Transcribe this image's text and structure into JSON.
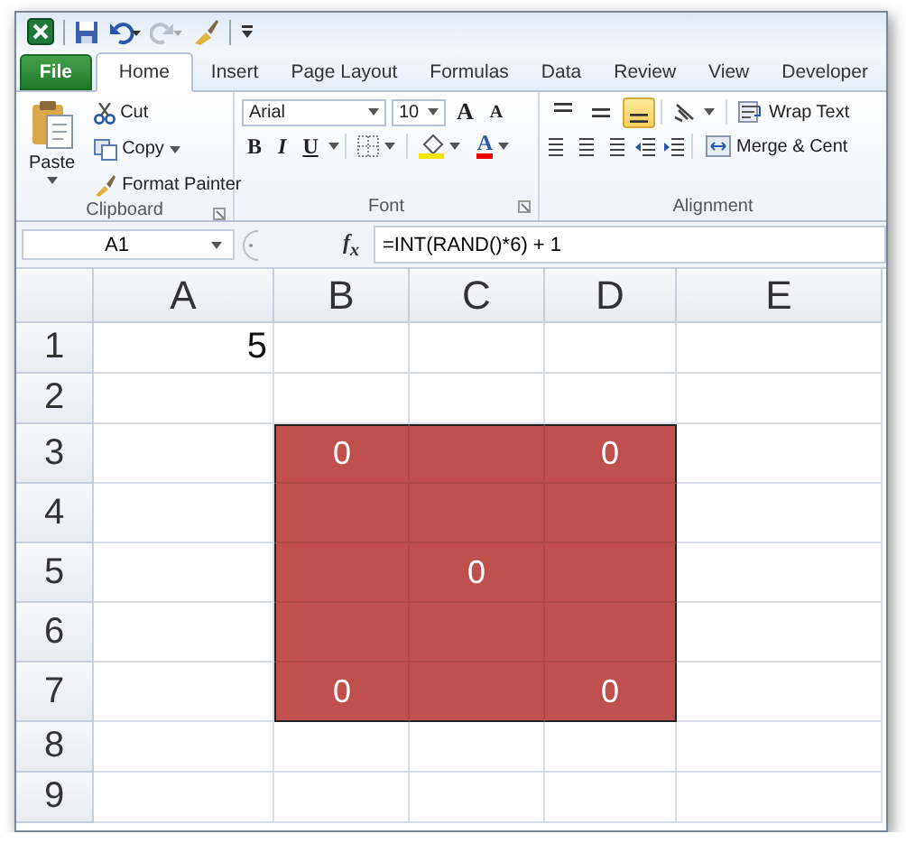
{
  "tabs": [
    {
      "label": "File",
      "kind": "file",
      "selected": false
    },
    {
      "label": "Home",
      "kind": "tab",
      "selected": true
    },
    {
      "label": "Insert",
      "kind": "tab",
      "selected": false
    },
    {
      "label": "Page Layout",
      "kind": "tab",
      "selected": false
    },
    {
      "label": "Formulas",
      "kind": "tab",
      "selected": false
    },
    {
      "label": "Data",
      "kind": "tab",
      "selected": false
    },
    {
      "label": "Review",
      "kind": "tab",
      "selected": false
    },
    {
      "label": "View",
      "kind": "tab",
      "selected": false
    },
    {
      "label": "Developer",
      "kind": "tab",
      "selected": false
    }
  ],
  "ribbon": {
    "clipboard": {
      "label": "Clipboard",
      "paste": "Paste",
      "cut": "Cut",
      "copy": "Copy",
      "format_painter": "Format Painter"
    },
    "font": {
      "label": "Font",
      "font_name": "Arial",
      "font_size": "10",
      "grow": "A",
      "shrink": "A",
      "bold": "B",
      "italic": "I",
      "underline": "U",
      "font_color": "A"
    },
    "alignment": {
      "label": "Alignment",
      "vertical": [
        {
          "selected": false
        },
        {
          "selected": false
        },
        {
          "selected": true
        }
      ],
      "wrap_text": "Wrap Text",
      "merge": "Merge & Cent"
    }
  },
  "formula_bar": {
    "name_box": "A1",
    "fx": "f$_{x}$",
    "formula": "=INT(RAND()*6) + 1"
  },
  "sheet": {
    "columns": [
      "A",
      "B",
      "C",
      "D",
      "E"
    ],
    "rows": [
      {
        "label": "1",
        "cells": [
          {
            "value": "5",
            "filled": false
          },
          {
            "filled": false
          },
          {
            "filled": false
          },
          {
            "filled": false
          },
          {
            "filled": false
          }
        ]
      },
      {
        "label": "2",
        "cells": [
          {
            "filled": false
          },
          {
            "filled": false
          },
          {
            "filled": false
          },
          {
            "filled": false
          },
          {
            "filled": false
          }
        ]
      },
      {
        "label": "3",
        "cells": [
          {
            "filled": false
          },
          {
            "value": "0",
            "filled": true
          },
          {
            "filled": true
          },
          {
            "value": "0",
            "filled": true
          },
          {
            "filled": false
          }
        ]
      },
      {
        "label": "4",
        "cells": [
          {
            "filled": false
          },
          {
            "filled": true
          },
          {
            "filled": true
          },
          {
            "filled": true
          },
          {
            "filled": false
          }
        ]
      },
      {
        "label": "5",
        "cells": [
          {
            "filled": false
          },
          {
            "filled": true
          },
          {
            "value": "0",
            "filled": true
          },
          {
            "filled": true
          },
          {
            "filled": false
          }
        ]
      },
      {
        "label": "6",
        "cells": [
          {
            "filled": false
          },
          {
            "filled": true
          },
          {
            "filled": true
          },
          {
            "filled": true
          },
          {
            "filled": false
          }
        ]
      },
      {
        "label": "7",
        "cells": [
          {
            "filled": false
          },
          {
            "value": "0",
            "filled": true
          },
          {
            "filled": true
          },
          {
            "value": "0",
            "filled": true
          },
          {
            "filled": false
          }
        ]
      },
      {
        "label": "8",
        "cells": [
          {
            "filled": false
          },
          {
            "filled": false
          },
          {
            "filled": false
          },
          {
            "filled": false
          },
          {
            "filled": false
          }
        ]
      },
      {
        "label": "9",
        "cells": [
          {
            "filled": false
          },
          {
            "filled": false
          },
          {
            "filled": false
          },
          {
            "filled": false
          },
          {
            "filled": false
          }
        ]
      }
    ]
  }
}
